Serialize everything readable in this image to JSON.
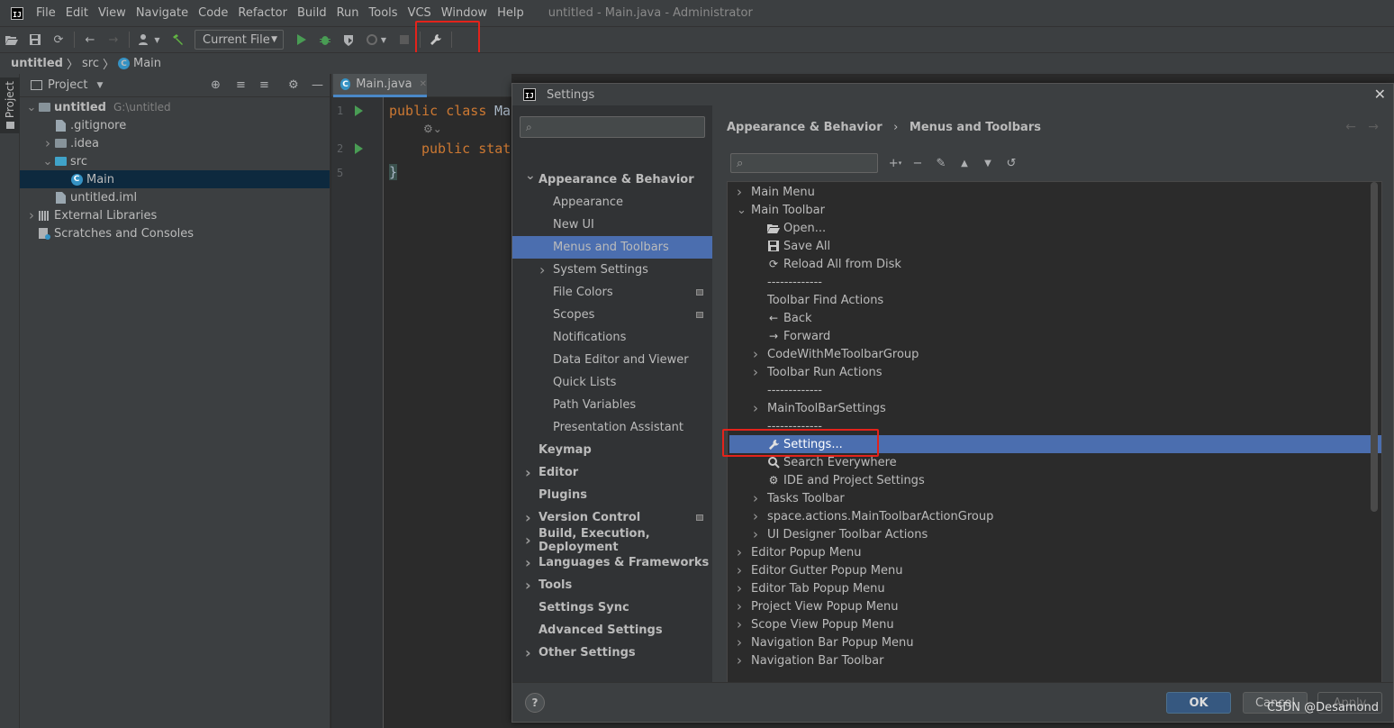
{
  "app": {
    "window_title": "untitled - Main.java - Administrator",
    "logo_text": "IJ"
  },
  "menu": [
    "File",
    "Edit",
    "View",
    "Navigate",
    "Code",
    "Refactor",
    "Build",
    "Run",
    "Tools",
    "VCS",
    "Window",
    "Help"
  ],
  "toolbar": {
    "run_config": "Current File"
  },
  "breadcrumb": [
    "untitled",
    "src",
    "Main"
  ],
  "project_panel": {
    "tab_label": "Project",
    "header_title": "Project",
    "tree": [
      {
        "label": "untitled",
        "extra": "G:\\untitled",
        "level": 0,
        "expanded": true,
        "icon": "folder-icon",
        "bold": true
      },
      {
        "label": ".gitignore",
        "level": 1,
        "icon": "file-icon"
      },
      {
        "label": ".idea",
        "level": 1,
        "collapsed": true,
        "icon": "folder-icon"
      },
      {
        "label": "src",
        "level": 1,
        "expanded": true,
        "icon": "source-folder-icon"
      },
      {
        "label": "Main",
        "level": 2,
        "icon": "class-icon",
        "selected": true
      },
      {
        "label": "untitled.iml",
        "level": 1,
        "icon": "module-file-icon"
      },
      {
        "label": "External Libraries",
        "level": 0,
        "collapsed": true,
        "icon": "library-icon"
      },
      {
        "label": "Scratches and Consoles",
        "level": 0,
        "icon": "scratches-icon"
      }
    ]
  },
  "editor": {
    "tab": "Main.java",
    "line_numbers": [
      "1",
      "2",
      "5"
    ],
    "lines": {
      "l1_kw": "public class",
      "l1_rest": " Ma",
      "l2_kw": "public stat",
      "l3": "}"
    }
  },
  "dialog": {
    "title": "Settings",
    "close": "✕",
    "search_placeholder": "",
    "nav": [
      {
        "label": "Appearance & Behavior",
        "bold": true,
        "expanded": true,
        "indent": 0
      },
      {
        "label": "Appearance",
        "indent": 1
      },
      {
        "label": "New UI",
        "indent": 1
      },
      {
        "label": "Menus and Toolbars",
        "indent": 1,
        "selected": true
      },
      {
        "label": "System Settings",
        "indent": 1,
        "collapsed": true
      },
      {
        "label": "File Colors",
        "indent": 1,
        "project": true
      },
      {
        "label": "Scopes",
        "indent": 1,
        "project": true
      },
      {
        "label": "Notifications",
        "indent": 1
      },
      {
        "label": "Data Editor and Viewer",
        "indent": 1
      },
      {
        "label": "Quick Lists",
        "indent": 1
      },
      {
        "label": "Path Variables",
        "indent": 1
      },
      {
        "label": "Presentation Assistant",
        "indent": 1
      },
      {
        "label": "Keymap",
        "bold": true,
        "indent": 0
      },
      {
        "label": "Editor",
        "bold": true,
        "collapsed": true,
        "indent": 0
      },
      {
        "label": "Plugins",
        "bold": true,
        "indent": 0
      },
      {
        "label": "Version Control",
        "bold": true,
        "collapsed": true,
        "indent": 0,
        "project": true
      },
      {
        "label": "Build, Execution, Deployment",
        "bold": true,
        "collapsed": true,
        "indent": 0
      },
      {
        "label": "Languages & Frameworks",
        "bold": true,
        "collapsed": true,
        "indent": 0
      },
      {
        "label": "Tools",
        "bold": true,
        "collapsed": true,
        "indent": 0
      },
      {
        "label": "Settings Sync",
        "bold": true,
        "indent": 0
      },
      {
        "label": "Advanced Settings",
        "bold": true,
        "indent": 0
      },
      {
        "label": "Other Settings",
        "bold": true,
        "collapsed": true,
        "indent": 0
      }
    ],
    "breadcrumb": [
      "Appearance & Behavior",
      "Menus and Toolbars"
    ],
    "tree": [
      {
        "label": "Main Menu",
        "level": 0,
        "twist": "collapsed"
      },
      {
        "label": "Main Toolbar",
        "level": 0,
        "twist": "expanded"
      },
      {
        "label": "Open...",
        "level": 1,
        "icon": "open-folder-icon"
      },
      {
        "label": "Save All",
        "level": 1,
        "icon": "save-icon"
      },
      {
        "label": "Reload All from Disk",
        "level": 1,
        "icon": "reload-icon"
      },
      {
        "label": "-------------",
        "level": 1,
        "icon": ""
      },
      {
        "label": "Toolbar Find Actions",
        "level": 1,
        "icon": ""
      },
      {
        "label": "Back",
        "level": 1,
        "icon": "back-arrow-icon"
      },
      {
        "label": "Forward",
        "level": 1,
        "icon": "forward-arrow-icon"
      },
      {
        "label": "CodeWithMeToolbarGroup",
        "level": 1,
        "twist": "collapsed",
        "icon": ""
      },
      {
        "label": "Toolbar Run Actions",
        "level": 1,
        "twist": "collapsed",
        "icon": ""
      },
      {
        "label": "-------------",
        "level": 1,
        "icon": ""
      },
      {
        "label": "MainToolBarSettings",
        "level": 1,
        "twist": "collapsed",
        "icon": ""
      },
      {
        "label": "-------------",
        "level": 1,
        "icon": ""
      },
      {
        "label": "Settings...",
        "level": 1,
        "icon": "wrench-icon",
        "selected": true
      },
      {
        "label": "Search Everywhere",
        "level": 1,
        "icon": "search-icon"
      },
      {
        "label": "IDE and Project Settings",
        "level": 1,
        "icon": "gear-icon"
      },
      {
        "label": "Tasks Toolbar",
        "level": 1,
        "twist": "collapsed",
        "icon": ""
      },
      {
        "label": "space.actions.MainToolbarActionGroup",
        "level": 1,
        "twist": "collapsed",
        "icon": ""
      },
      {
        "label": "UI Designer Toolbar Actions",
        "level": 1,
        "twist": "collapsed",
        "icon": ""
      },
      {
        "label": "Editor Popup Menu",
        "level": 0,
        "twist": "collapsed"
      },
      {
        "label": "Editor Gutter Popup Menu",
        "level": 0,
        "twist": "collapsed"
      },
      {
        "label": "Editor Tab Popup Menu",
        "level": 0,
        "twist": "collapsed"
      },
      {
        "label": "Project View Popup Menu",
        "level": 0,
        "twist": "collapsed"
      },
      {
        "label": "Scope View Popup Menu",
        "level": 0,
        "twist": "collapsed"
      },
      {
        "label": "Navigation Bar Popup Menu",
        "level": 0,
        "twist": "collapsed"
      },
      {
        "label": "Navigation Bar Toolbar",
        "level": 0,
        "twist": "collapsed"
      }
    ],
    "buttons": {
      "help": "?",
      "ok": "OK",
      "cancel": "Cancel",
      "apply": "Apply"
    }
  },
  "watermark": "CSDN @Desamond",
  "colors": {
    "selection": "#4b6eaf",
    "accent_red": "#e3231b",
    "run_green": "#499c54",
    "keyword": "#cc7832"
  }
}
